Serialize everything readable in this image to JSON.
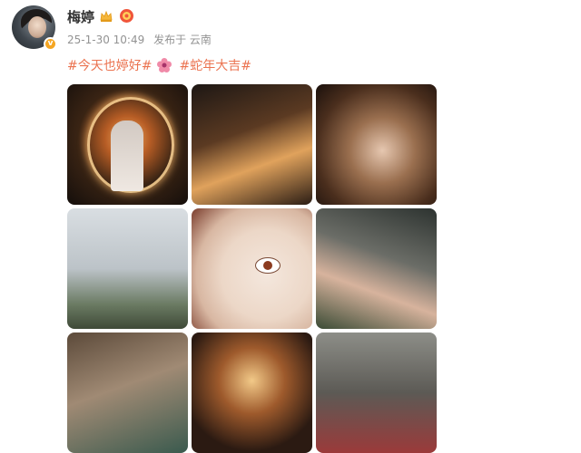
{
  "user": {
    "name": "梅婷",
    "verified_symbol": "v",
    "crown_icon": "crown-icon",
    "medal_icon": "medal-icon"
  },
  "meta": {
    "date": "25-1-30 10:49",
    "location": "发布于 云南"
  },
  "post": {
    "hashtag_1": "#今天也婷好#",
    "hashtag_2": "#蛇年大吉#",
    "flower_icon": "flower-icon",
    "link_color": "#eb7350"
  },
  "photos": {
    "count": 9,
    "icons": [
      "sparkler-ring-photo",
      "firework-photo",
      "light-painting-selfie-photo",
      "outdoor-lake-photo",
      "face-closeup-photo",
      "tongue-out-selfie-photo",
      "group-selfie-photo",
      "fireworks-night-photo",
      "winter-hat-photo"
    ]
  }
}
